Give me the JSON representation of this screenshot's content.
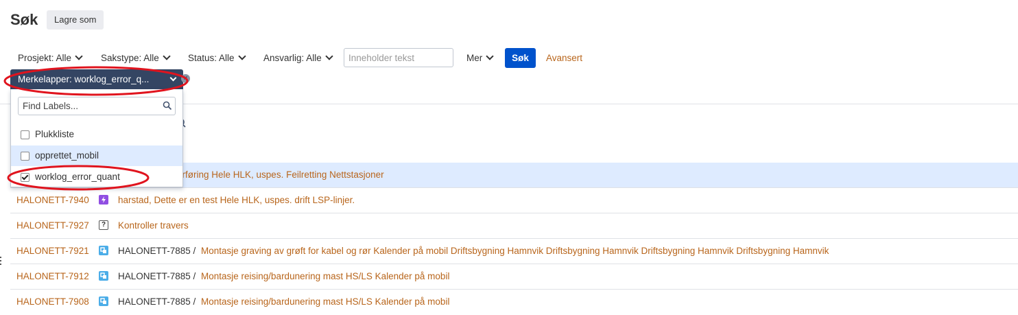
{
  "header": {
    "title": "Søk",
    "save_as": "Lagre som"
  },
  "filters": {
    "project": "Prosjekt: Alle",
    "issuetype": "Sakstype: Alle",
    "status": "Status: Alle",
    "assignee": "Ansvarlig: Alle",
    "text_placeholder": "Inneholder tekst",
    "more": "Mer",
    "search_button": "Søk",
    "advanced": "Avansert",
    "labels": "Merkelapper: worklog_error_q..."
  },
  "labels_dropdown": {
    "placeholder": "Find Labels...",
    "options": [
      {
        "label": "Plukkliste",
        "checked": false
      },
      {
        "label": "opprettet_mobil",
        "checked": false,
        "highlighted": true
      },
      {
        "label": "worklog_error_quant",
        "checked": true
      }
    ]
  },
  "results": [
    {
      "key": "",
      "type_icon": "",
      "parent": "",
      "summary": "erføring Hele HLK, uspes. Feilretting Nettstasjoner",
      "selected": true
    },
    {
      "key": "HALONETT-7940",
      "type_icon": "purple-bolt-icon",
      "parent": "",
      "summary": "harstad, Dette er en test Hele HLK, uspes. drift LSP-linjer."
    },
    {
      "key": "HALONETT-7927",
      "type_icon": "question-icon",
      "parent": "",
      "summary": "Kontroller travers"
    },
    {
      "key": "HALONETT-7921",
      "type_icon": "subtask-icon",
      "parent": "HALONETT-7885 /",
      "summary": "Montasje graving av grøft for kabel og rør Kalender på mobil Driftsbygning Hamnvik Driftsbygning Hamnvik Driftsbygning Hamnvik Driftsbygning Hamnvik"
    },
    {
      "key": "HALONETT-7912",
      "type_icon": "subtask-icon",
      "parent": "HALONETT-7885 /",
      "summary": "Montasje reising/bardunering mast HS/LS Kalender på mobil"
    },
    {
      "key": "HALONETT-7908",
      "type_icon": "subtask-icon",
      "parent": "HALONETT-7885 /",
      "summary": "Montasje reising/bardunering mast HS/LS Kalender på mobil"
    }
  ],
  "colors": {
    "link": "#b8651b",
    "primary": "#0052cc",
    "label_filter_bg": "#344563",
    "highlight": "#deebff",
    "annotation": "#e0141e"
  }
}
